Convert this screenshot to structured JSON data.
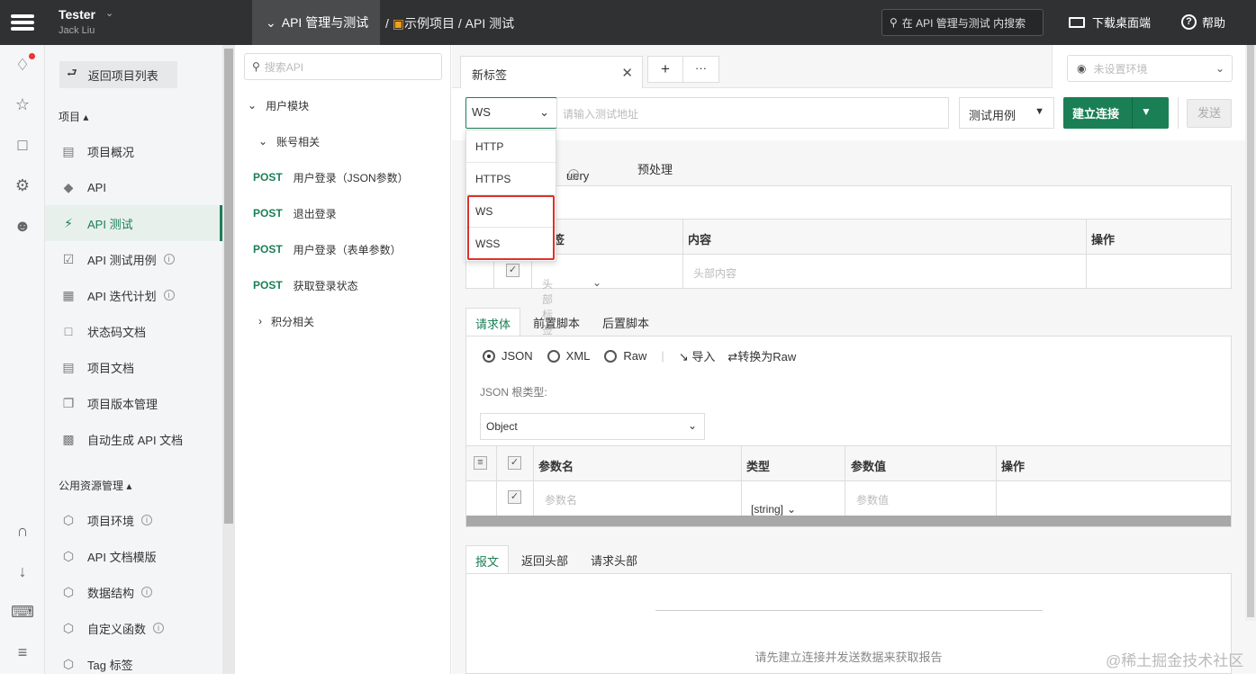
{
  "topbar": {
    "user_name": "Tester",
    "user_sub": "Jack Liu",
    "module_label": "API 管理与测试",
    "breadcrumb_sep": "/",
    "breadcrumb_project": "示例项目",
    "breadcrumb_page": "/ API 测试",
    "search_placeholder": "在 API 管理与测试 内搜索",
    "download_label": "下载桌面端",
    "help_label": "帮助"
  },
  "sidebar": {
    "back_label": "返回项目列表",
    "section_project": "项目",
    "section_shared": "公用资源管理",
    "items": [
      {
        "label": "项目概况",
        "icon": "overview-icon"
      },
      {
        "label": "API",
        "icon": "tag-icon"
      },
      {
        "label": "API 测试",
        "icon": "lightning-icon"
      },
      {
        "label": "API 测试用例",
        "icon": "clipboard-icon"
      },
      {
        "label": "API 迭代计划",
        "icon": "calendar-icon"
      },
      {
        "label": "状态码文档",
        "icon": "doc-icon"
      },
      {
        "label": "项目文档",
        "icon": "list-doc-icon"
      },
      {
        "label": "项目版本管理",
        "icon": "copy-icon"
      },
      {
        "label": "自动生成 API 文档",
        "icon": "robot-icon"
      }
    ],
    "shared_items": [
      {
        "label": "项目环境"
      },
      {
        "label": "API 文档模版"
      },
      {
        "label": "数据结构"
      },
      {
        "label": "自定义函数"
      },
      {
        "label": "Tag 标签"
      }
    ]
  },
  "tree": {
    "search_placeholder": "搜索API",
    "group_user": "用户模块",
    "group_account": "账号相关",
    "method": "POST",
    "apis": [
      "用户登录（JSON参数）",
      "退出登录",
      "用户登录（表单参数）",
      "获取登录状态"
    ],
    "group_points": "积分相关"
  },
  "tabs": {
    "new_tab": "新标签",
    "add": "+",
    "more": "···"
  },
  "env": {
    "placeholder": "未设置环境"
  },
  "request": {
    "protocol": "WS",
    "url_placeholder": "请输入测试地址",
    "case_label": "测试用例",
    "connect_label": "建立连接",
    "send_label": "发送",
    "sub_tabs": [
      "uery参数",
      "预处理"
    ]
  },
  "protocol_dropdown": {
    "options": [
      "HTTP",
      "HTTPS",
      "WS",
      "WSS"
    ]
  },
  "headers_table": {
    "col_name_tail": "签",
    "col_content": "内容",
    "col_action": "操作",
    "tag_placeholder": "头部标签",
    "content_placeholder": "头部内容"
  },
  "body": {
    "tabs": [
      "请求体",
      "前置脚本",
      "后置脚本"
    ],
    "formats": [
      "JSON",
      "XML",
      "Raw"
    ],
    "import_label": "导入",
    "convert_label": "转换为Raw",
    "root_type_label": "JSON 根类型:",
    "root_type_value": "Object",
    "cols": [
      "参数名",
      "类型",
      "参数值",
      "操作"
    ],
    "name_placeholder": "参数名",
    "type_value": "[string]",
    "value_placeholder": "参数值"
  },
  "response": {
    "tabs": [
      "报文",
      "返回头部",
      "请求头部"
    ],
    "message": "请先建立连接并发送数据来获取报告"
  },
  "watermark": "@稀土掘金技术社区",
  "colors": {
    "accent": "#1a7f55",
    "topbar": "#303133",
    "highlight": "#e0302a"
  }
}
